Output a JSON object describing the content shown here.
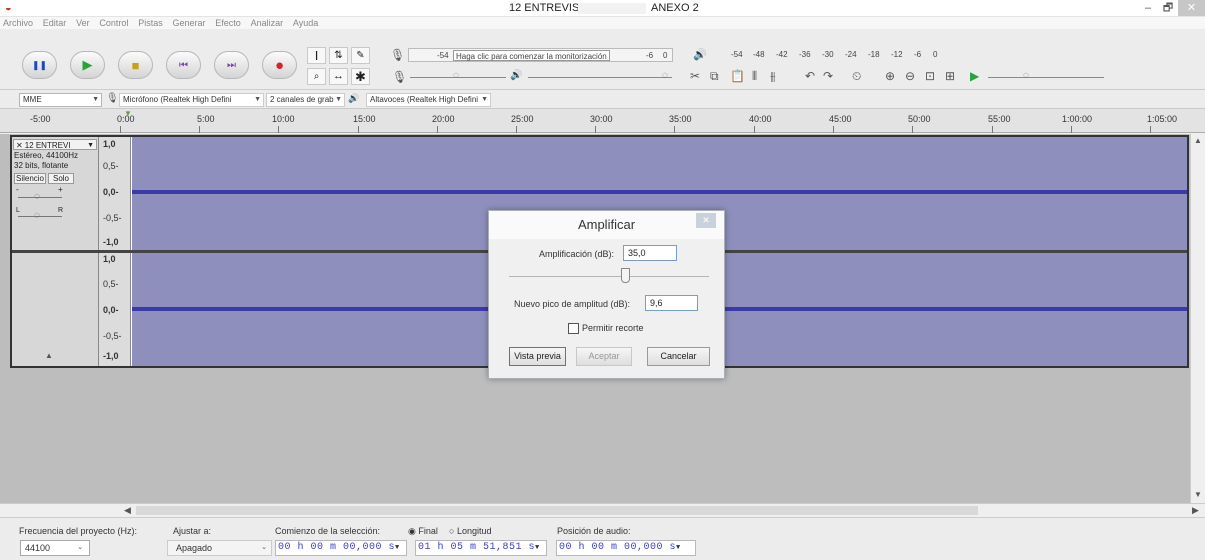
{
  "window": {
    "title_left": "12 ENTREVISTA",
    "title_right": "ANEXO 2",
    "minimize": "–",
    "maximize": "🗗",
    "close": "✕"
  },
  "menu": [
    "Archivo",
    "Editar",
    "Ver",
    "Control",
    "Pistas",
    "Generar",
    "Efecto",
    "Analizar",
    "Ayuda"
  ],
  "toolbar": {
    "pause_icon": "❚❚",
    "play_icon": "▶",
    "stop_icon": "■",
    "skip_start_icon": "⏮",
    "skip_end_icon": "⏭",
    "record_icon": "●",
    "monitor_text": "Haga clic para comenzar la monitorización",
    "record_meter_scale": [
      "-54",
      "-6",
      "0"
    ],
    "play_meter_scale": [
      "-54",
      "-48",
      "-42",
      "-36",
      "-30",
      "-24",
      "-18",
      "-12",
      "-6",
      "0"
    ]
  },
  "devices": {
    "host": "MME",
    "input_device": "Micrófono (Realtek High Defini",
    "channels": "2 canales de grab",
    "output_device": "Altavoces (Realtek High Defini"
  },
  "ruler": {
    "labels": [
      "-5:00",
      "0:00",
      "5:00",
      "10:00",
      "15:00",
      "20:00",
      "25:00",
      "30:00",
      "35:00",
      "40:00",
      "45:00",
      "50:00",
      "55:00",
      "1:00:00",
      "1:05:00"
    ]
  },
  "track": {
    "name": "12 ENTREVI",
    "info_line1": "Estéreo, 44100Hz",
    "info_line2": "32 bits, flotante",
    "mute": "Silencio",
    "solo": "Solo",
    "gain_minus": "-",
    "gain_plus": "+",
    "pan_left": "L",
    "pan_right": "R",
    "collapse": "▲",
    "scale_top": [
      "1,0",
      "0,5-",
      "0,0-",
      "-0,5-",
      "-1,0"
    ],
    "scale_bottom": [
      "1,0",
      "0,5-",
      "0,0-",
      "-0,5-",
      "-1,0"
    ]
  },
  "dialog": {
    "title": "Amplificar",
    "close": "✕",
    "amp_label": "Amplificación (dB):",
    "amp_value": "35,0",
    "amp_slider_level": 0.58,
    "peak_label": "Nuevo pico de amplitud (dB):",
    "peak_value": "9,6",
    "clip_label": "Permitir recorte",
    "clip_checked": false,
    "preview": "Vista previa",
    "accept": "Aceptar",
    "cancel": "Cancelar"
  },
  "status": {
    "rate_label": "Frecuencia del proyecto (Hz):",
    "rate_value": "44100",
    "snap_label": "Ajustar a:",
    "snap_value": "Apagado",
    "sel_start_label": "Comienzo de la selección:",
    "end_option": "Final",
    "length_option": "Longitud",
    "sel_start": "00 h 00 m 00,000 s",
    "sel_end": "01 h 05 m 51,851 s",
    "audio_pos_label": "Posición de audio:",
    "audio_pos": "00 h 00 m 00,000 s"
  }
}
